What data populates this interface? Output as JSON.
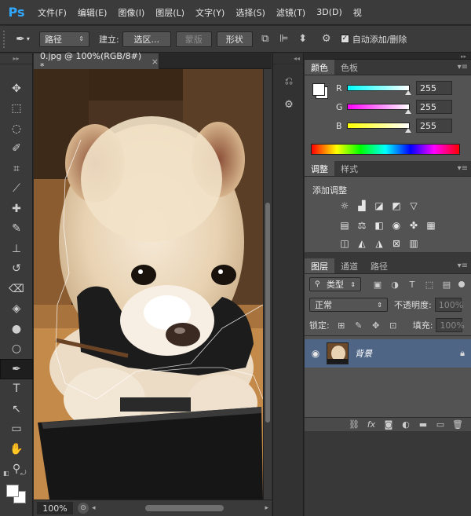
{
  "app": {
    "logo": "Ps"
  },
  "menu": [
    "文件(F)",
    "编辑(E)",
    "图像(I)",
    "图层(L)",
    "文字(Y)",
    "选择(S)",
    "滤镜(T)",
    "3D(D)",
    "视"
  ],
  "options": {
    "mode_select": "路径",
    "create_label": "建立:",
    "selection_btn": "选区...",
    "mask_btn": "蒙版",
    "shape_btn": "形状",
    "auto_add_label": "自动添加/删除",
    "auto_add_checked": true
  },
  "document": {
    "tab_title": "0.jpg @ 100%(RGB/8#) *",
    "close": "×",
    "zoom": "100%"
  },
  "icons": {
    "pen": "✒",
    "move": "✥",
    "marquee": "⬚",
    "lasso": "◌",
    "quick-select": "✐",
    "crop": "⌗",
    "eyedropper": "⟋",
    "healing": "✚",
    "brush": "✎",
    "stamp": "⊥",
    "history-brush": "↺",
    "eraser": "⌫",
    "bucket": "◈",
    "blur": "●",
    "dodge": "○",
    "text": "T",
    "path-select": "↖",
    "rectangle": "▭",
    "hand": "✋",
    "zoom": "⚲"
  },
  "color_panel": {
    "tabs": [
      "颜色",
      "色板"
    ],
    "channels": [
      {
        "label": "R",
        "value": "255",
        "color": "#00ffff"
      },
      {
        "label": "G",
        "value": "255",
        "color": "#ff00ff"
      },
      {
        "label": "B",
        "value": "255",
        "color": "#ffff00"
      }
    ]
  },
  "adjust_panel": {
    "tabs": [
      "调整",
      "样式"
    ],
    "title": "添加调整"
  },
  "layers_panel": {
    "tabs": [
      "图层",
      "通道",
      "路径"
    ],
    "kind": "类型",
    "blend": "正常",
    "opacity_label": "不透明度:",
    "opacity_value": "100%",
    "lock_label": "锁定:",
    "fill_label": "填充:",
    "fill_value": "100%",
    "layer_name": "背景"
  }
}
